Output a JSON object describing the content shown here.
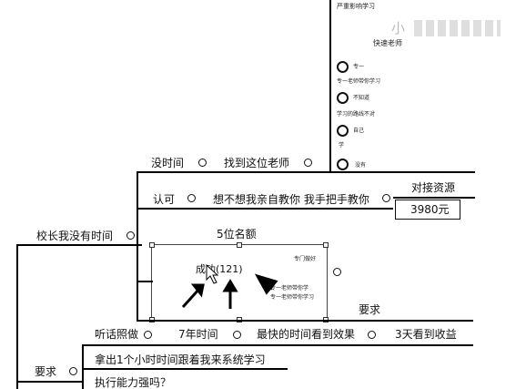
{
  "right_panel": {
    "top_label": "严重影响学习",
    "blurred_title": "小 ",
    "blurred_sub": "快速老师",
    "item1_label": "专一",
    "item1_sub": "专一老师带你学习",
    "item2_label": "不知道",
    "item2_sub": "学习的路线不对",
    "item3_label": "自己",
    "item3_sub": "学",
    "item4_label": "没有"
  },
  "map": {
    "no_time": "没时间",
    "find_teacher": "找到这位老师",
    "approve": "认可",
    "teach_sentence": "想不想我亲自教你 我手把手教你",
    "connect_resource": "对接资源",
    "price": "3980元",
    "principal_no_time": "校长我没有时间",
    "quota": "5位名额",
    "image_caption": "成功(121)",
    "requirement": "要求",
    "listen": "听话照做",
    "seven_years": "7年时间",
    "fastest": "最快的时间看到效果",
    "three_days": "3天看到收益",
    "requirement_left": "要求",
    "take_hour": "拿出1个小时时间跟着我来系统学习",
    "execution": "执行能力强吗？"
  },
  "image_node": {
    "note_top": "专门做好",
    "note_mid1": "专一老师带你学",
    "note_mid2": "专一老师带你学习"
  }
}
